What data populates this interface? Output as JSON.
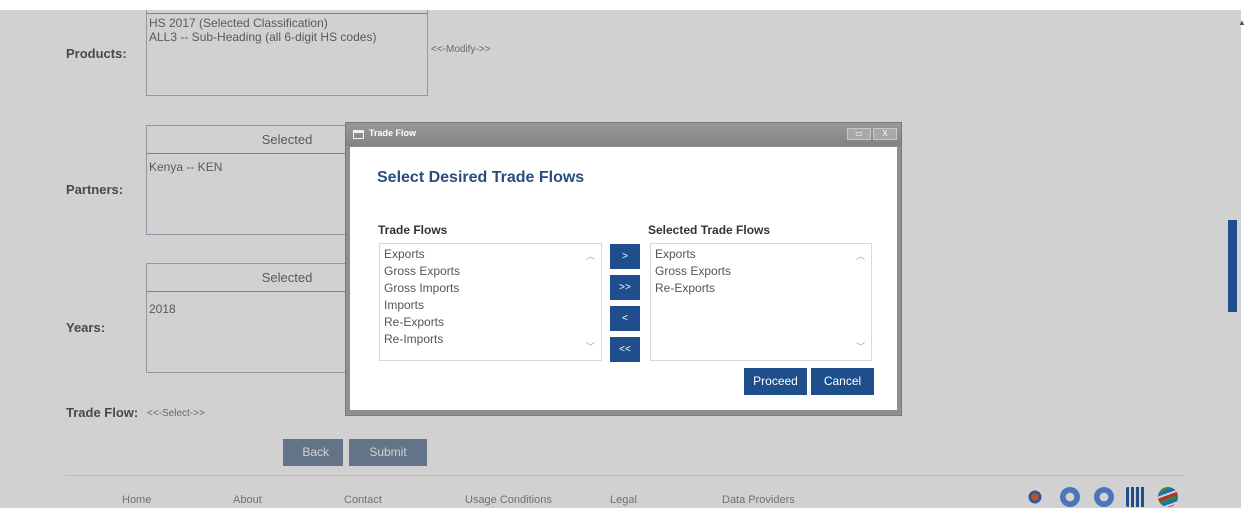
{
  "form": {
    "products": {
      "label": "Products:",
      "lines": [
        "HS 2017 (Selected Classification)",
        "ALL3 -- Sub-Heading (all 6-digit HS codes)"
      ],
      "modify_link": "<<-Modify->>"
    },
    "partners": {
      "label": "Partners:",
      "header": "Selected",
      "value": "Kenya -- KEN"
    },
    "years": {
      "label": "Years:",
      "header": "Selected",
      "value": "2018"
    },
    "trade_flow": {
      "label": "Trade Flow:",
      "select_link": "<<-Select->>"
    },
    "back_label": "Back",
    "submit_label": "Submit"
  },
  "footer": {
    "links": [
      "Home",
      "About",
      "Contact",
      "Usage Conditions",
      "Legal",
      "Data Providers"
    ]
  },
  "dialog": {
    "title": "Trade Flow",
    "restore_glyph": "▭",
    "close_glyph": "X",
    "heading": "Select Desired Trade Flows",
    "available_label": "Trade Flows",
    "available": [
      "Exports",
      "Gross Exports",
      "Gross Imports",
      "Imports",
      "Re-Exports",
      "Re-Imports"
    ],
    "selected_label": "Selected Trade Flows",
    "selected": [
      "Exports",
      "Gross Exports",
      "Re-Exports"
    ],
    "move_buttons": [
      ">",
      ">>",
      "<",
      "<<"
    ],
    "proceed_label": "Proceed",
    "cancel_label": "Cancel"
  },
  "colors": {
    "primary": "#1f4e8c",
    "page_button": "#7b8ea6",
    "heading": "#2a4c7e"
  }
}
